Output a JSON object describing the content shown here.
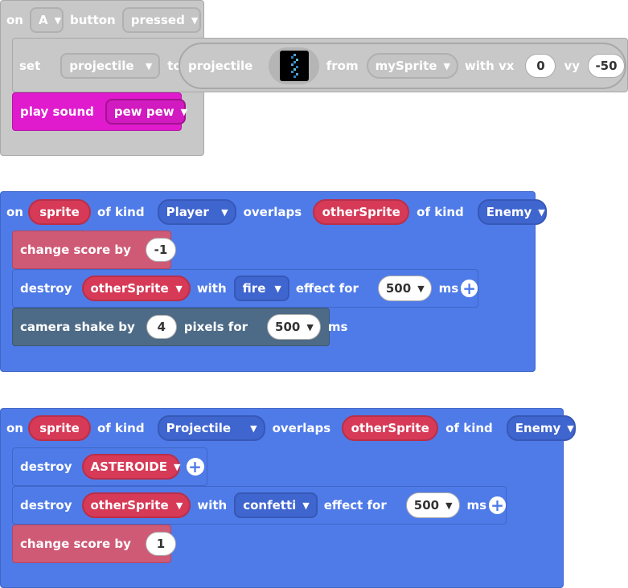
{
  "event1": {
    "on": "on",
    "key": "A",
    "button": "button",
    "state": "pressed",
    "set": "set",
    "variable": "projectile",
    "to": "to",
    "projectile_label": "projectile",
    "from": "from",
    "source": "mySprite",
    "with_vx": "with vx",
    "vx": "0",
    "vy_label": "vy",
    "vy": "-50",
    "play_sound": "play sound",
    "sound": "pew pew",
    "sprite_image_icon": "pixel-sprite-icon"
  },
  "event2": {
    "on": "on",
    "sprite": "sprite",
    "of_kind": "of kind",
    "kind1": "Player",
    "overlaps": "overlaps",
    "other": "otherSprite",
    "of_kind2": "of kind",
    "kind2": "Enemy",
    "change_score": "change score by",
    "score_delta": "-1",
    "destroy": "destroy",
    "destroy_target": "otherSprite",
    "with": "with",
    "effect": "fire",
    "effect_for": "effect for",
    "duration": "500",
    "ms": "ms",
    "camera_shake": "camera shake by",
    "shake_px": "4",
    "pixels_for": "pixels for",
    "shake_ms": "500",
    "shake_unit": "ms"
  },
  "event3": {
    "on": "on",
    "sprite": "sprite",
    "of_kind": "of kind",
    "kind1": "Projectile",
    "overlaps": "overlaps",
    "other": "otherSprite",
    "of_kind2": "of kind",
    "kind2": "Enemy",
    "destroy1": "destroy",
    "destroy1_target": "ASTEROIDE",
    "destroy2": "destroy",
    "destroy2_target": "otherSprite",
    "with": "with",
    "effect": "confetti",
    "effect_for": "effect for",
    "duration": "500",
    "ms": "ms",
    "change_score": "change score by",
    "score_delta": "1"
  },
  "colors": {
    "gray_block": "#c8c8c8",
    "blue_block": "#4f7be8",
    "pink_block": "#e01bce",
    "rose_block": "#cf5a76",
    "slate_block": "#4d6a86",
    "red_pill": "#d63a57"
  }
}
